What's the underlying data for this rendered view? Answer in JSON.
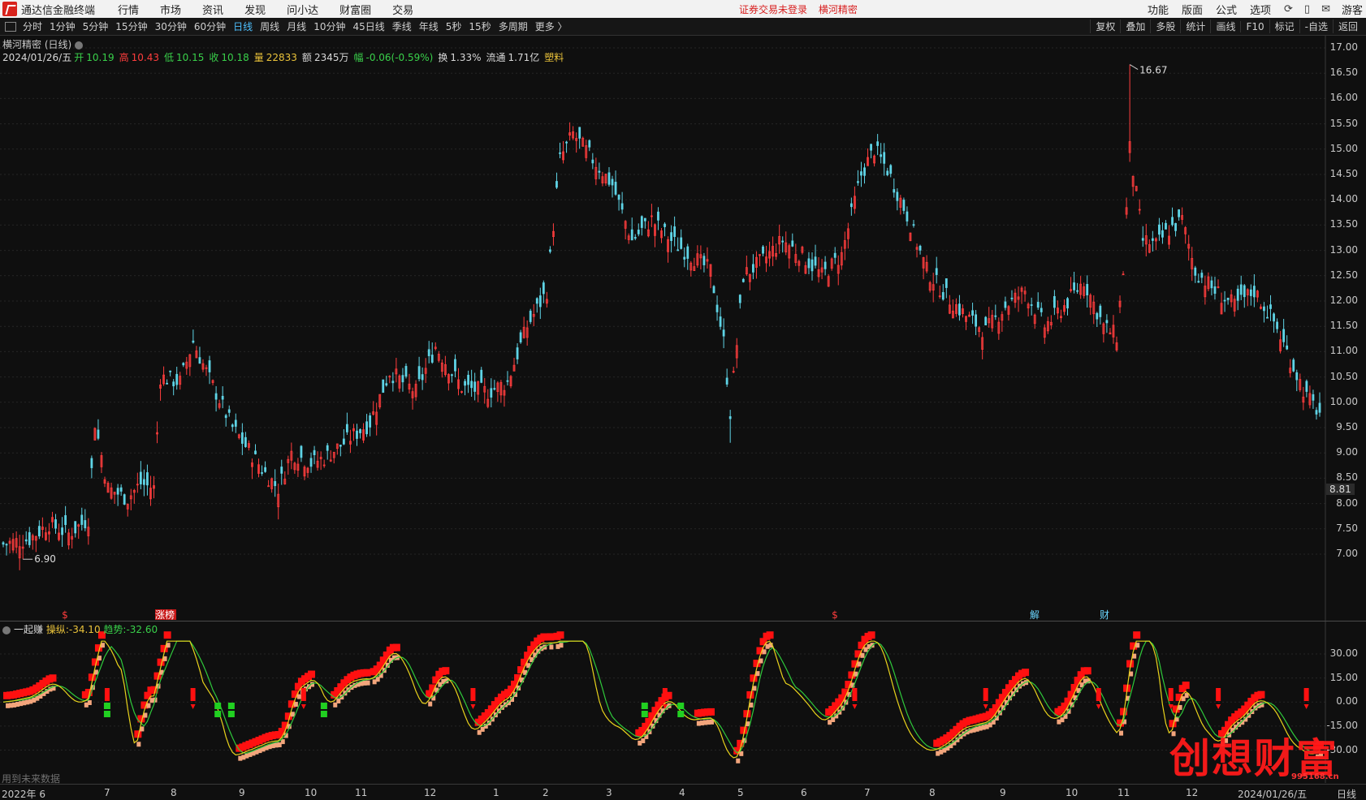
{
  "app": {
    "name": "通达信金融终端",
    "menus": [
      "行情",
      "市场",
      "资讯",
      "发现",
      "问小达",
      "财富圈",
      "交易"
    ],
    "notice": "证券交易未登录",
    "current_stock": "横河精密",
    "right_menus": [
      "功能",
      "版面",
      "公式",
      "选项"
    ],
    "user": "游客"
  },
  "periods": [
    "分时",
    "1分钟",
    "5分钟",
    "15分钟",
    "30分钟",
    "60分钟",
    "日线",
    "周线",
    "月线",
    "10分钟",
    "45日线",
    "季线",
    "年线",
    "5秒",
    "15秒",
    "多周期",
    "更多 〉"
  ],
  "active_period": "日线",
  "toolbar_right": [
    "复权",
    "叠加",
    "多股",
    "统计",
    "画线",
    "F10",
    "标记",
    "-自选",
    "返回"
  ],
  "chart_title": "横河精密 (日线)",
  "quote": {
    "date": "2024/01/26/五",
    "open_label": "开",
    "open": "10.19",
    "high_label": "高",
    "high": "10.43",
    "low_label": "低",
    "low": "10.15",
    "close_label": "收",
    "close": "10.18",
    "volume_label": "量",
    "volume": "22833",
    "amount_label": "额",
    "amount": "2345万",
    "change_label": "幅",
    "change": "-0.06(-0.59%)",
    "turnover_label": "换",
    "turnover": "1.33%",
    "float_label": "流通",
    "float_cap": "1.71亿",
    "sector": "塑料"
  },
  "colors": {
    "up": "#ff3d3d",
    "down": "#5fd4e6",
    "bg": "#0f0f0f",
    "ma_yellow": "#e8d21c",
    "ma_green": "#2fc93b",
    "bar_red": "#ff1010",
    "bar_peach": "#f2a57c",
    "signal_green": "#21d021"
  },
  "price_axis": {
    "labels": [
      "17.00",
      "16.50",
      "16.00",
      "15.50",
      "15.00",
      "14.50",
      "14.00",
      "13.50",
      "13.00",
      "12.50",
      "12.00",
      "11.50",
      "11.00",
      "10.50",
      "10.00",
      "9.50",
      "9.00",
      "8.50",
      "8.00",
      "7.50",
      "7.00"
    ],
    "current_price_box": "8.81"
  },
  "annotations": {
    "max_label": "16.67",
    "min_label": "6.90"
  },
  "event_markers": [
    {
      "text": "$",
      "color": "#ff3d3d"
    },
    {
      "text": "涨榜",
      "color": "#ffffff",
      "bg": "#c81818"
    },
    {
      "text": "$",
      "color": "#ff3d3d"
    },
    {
      "text": "解",
      "color": "#6ad6ff"
    },
    {
      "text": "财",
      "color": "#6ad6ff"
    }
  ],
  "indicator": {
    "name": "一起赚",
    "line1_label": "操纵:",
    "line1_value": "-34.10",
    "line2_label": "趋势:",
    "line2_value": "-32.60",
    "axis_labels": [
      "30.00",
      "15.00",
      "0.00",
      "-15.00",
      "-30.00"
    ],
    "note": "用到未来数据"
  },
  "x_axis": [
    "2022年 6",
    "7",
    "8",
    "9",
    "10",
    "11",
    "12",
    "1",
    "2",
    "3",
    "4",
    "5",
    "6",
    "7",
    "8",
    "9",
    "10",
    "11",
    "12",
    "2024/01/26/五",
    "日线"
  ],
  "watermark": {
    "text": "创想财富",
    "url": "995168.cn"
  },
  "chart_data": {
    "type": "candlestick",
    "ylim": [
      6.9,
      17.0
    ],
    "annotated_high": 16.67,
    "annotated_low": 6.9,
    "anchor_closes": [
      [
        0,
        7.2
      ],
      [
        8,
        7.3
      ],
      [
        14,
        7.6
      ],
      [
        20,
        7.4
      ],
      [
        26,
        7.7
      ],
      [
        28,
        9.6
      ],
      [
        32,
        8.3
      ],
      [
        38,
        8.1
      ],
      [
        42,
        8.4
      ],
      [
        46,
        8.3
      ],
      [
        48,
        10.5
      ],
      [
        54,
        10.4
      ],
      [
        58,
        11.2
      ],
      [
        62,
        10.6
      ],
      [
        70,
        9.5
      ],
      [
        80,
        8.6
      ],
      [
        84,
        8.3
      ],
      [
        88,
        9.0
      ],
      [
        94,
        8.8
      ],
      [
        98,
        8.9
      ],
      [
        104,
        9.2
      ],
      [
        112,
        9.6
      ],
      [
        118,
        10.6
      ],
      [
        126,
        10.2
      ],
      [
        132,
        11.1
      ],
      [
        140,
        10.3
      ],
      [
        148,
        10.2
      ],
      [
        154,
        10.4
      ],
      [
        160,
        11.5
      ],
      [
        166,
        12.2
      ],
      [
        170,
        14.8
      ],
      [
        174,
        15.3
      ],
      [
        180,
        14.8
      ],
      [
        186,
        14.3
      ],
      [
        192,
        13.2
      ],
      [
        198,
        13.6
      ],
      [
        204,
        13.2
      ],
      [
        210,
        12.9
      ],
      [
        216,
        12.6
      ],
      [
        220,
        11.2
      ],
      [
        222,
        9.8
      ],
      [
        226,
        12.5
      ],
      [
        232,
        12.8
      ],
      [
        238,
        13.2
      ],
      [
        244,
        12.9
      ],
      [
        250,
        12.5
      ],
      [
        256,
        12.9
      ],
      [
        262,
        14.5
      ],
      [
        266,
        15.0
      ],
      [
        270,
        14.6
      ],
      [
        276,
        13.7
      ],
      [
        282,
        12.6
      ],
      [
        288,
        12.1
      ],
      [
        294,
        11.7
      ],
      [
        300,
        11.4
      ],
      [
        306,
        11.9
      ],
      [
        312,
        12.2
      ],
      [
        318,
        11.5
      ],
      [
        324,
        11.9
      ],
      [
        330,
        12.4
      ],
      [
        336,
        11.5
      ],
      [
        340,
        11.3
      ],
      [
        342,
        12.6
      ],
      [
        344,
        15.0
      ],
      [
        348,
        13.2
      ],
      [
        352,
        13.1
      ],
      [
        356,
        13.4
      ],
      [
        360,
        13.6
      ],
      [
        364,
        12.6
      ],
      [
        370,
        12.2
      ],
      [
        376,
        11.9
      ],
      [
        382,
        12.2
      ],
      [
        388,
        11.6
      ],
      [
        394,
        10.7
      ],
      [
        398,
        10.1
      ],
      [
        402,
        9.8
      ]
    ],
    "indicator_range": [
      -40,
      40
    ]
  }
}
